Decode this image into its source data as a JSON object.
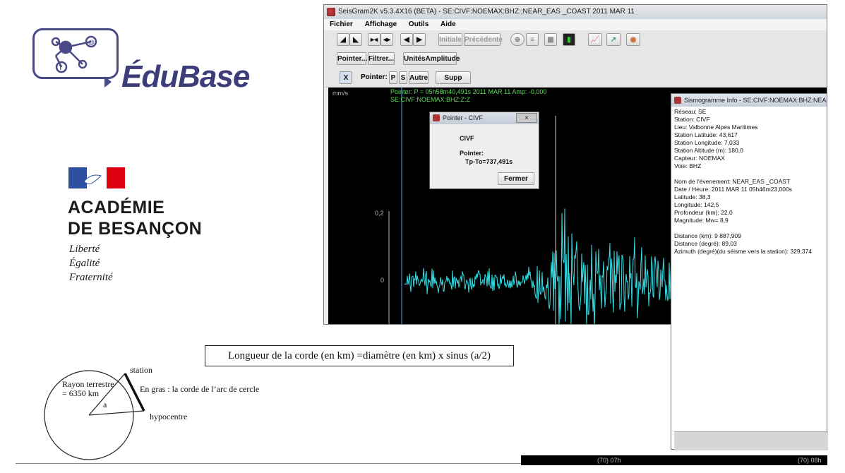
{
  "brand": {
    "logo_name": "ÉduBase",
    "academie_line1": "ACADÉMIE",
    "academie_line2": "DE BESANÇON",
    "devise": [
      "Liberté",
      "Égalité",
      "Fraternité"
    ],
    "colors": {
      "logo": "#3d3d7a",
      "flag_blue": "#2f4fa1",
      "flag_red": "#e1000f"
    }
  },
  "window": {
    "title": "SeisGram2K v5.3.4X16 (BETA) - SE:CIVF:NOEMAX:BHZ:;NEAR_EAS _COAST 2011 MAR 11",
    "menu": [
      "Fichier",
      "Affichage",
      "Outils",
      "Aide"
    ],
    "toolbar": {
      "initiale": "Initiale",
      "precedente": "Précédente",
      "pointer": "Pointer...",
      "filtrer": "Filtrer...",
      "unites": "UnitésAmplitude",
      "x": "X",
      "pointer_label": "Pointer:",
      "p": "P",
      "s": "S",
      "autre": "Autre",
      "supp": "Supp Tous"
    },
    "plot": {
      "unit": "mm/s",
      "pointer_line1": "Pointer: P = 05h58m40,491s 2011 MAR 11 Amp: -0,000",
      "pointer_line2": "SE:CIVF:NOEMAX:BHZ:Z:Z",
      "y_label_top": "0,2",
      "y_label_zero": "0",
      "time_labels": [
        "(70) 07h",
        "(70) 08h"
      ],
      "trace_color": "#33e0e8",
      "marker_color": "#3b8fd6"
    }
  },
  "dialog": {
    "title": "Pointer - CIVF",
    "close": "×",
    "station": "CIVF",
    "pointer_label": "Pointer:",
    "value": "Tp-To=737,491s",
    "button": "Fermer"
  },
  "info": {
    "title": "Sismogramme Info - SE:CIVF:NOEMAX:BHZ:NEAR_EAS _COAST",
    "lines": [
      "Réseau: SE",
      "Station: CIVF",
      "Lieu: Valbonne Alpes Maritimes",
      "Station Latitude: 43,617",
      "Station Longitude: 7,033",
      "Station Altitude (m): 180,0",
      "Capteur: NOEMAX",
      "Voie: BHZ",
      "",
      "Nom de l'évenement: NEAR_EAS _COAST",
      "Date / Heure: 2011 MAR 11  05h46m23,000s",
      "Latitude: 38,3",
      "Longitude: 142,5",
      "Profondeur (km): 22,0",
      "Magnitude: Mw= 8,9",
      "",
      "Distance (km): 9 887,909",
      "Distance (degré): 89,03",
      "Azimuth (degré)(du séisme vers la station): 329,374"
    ]
  },
  "diagram": {
    "formula": "Longueur de la corde (en km) =diamètre (en km) x sinus (a/2)",
    "rayon1": "Rayon terrestre",
    "rayon2": "= 6350 km",
    "angle": "a",
    "station": "station",
    "gras": "En gras : la corde de l’arc de cercle",
    "hypocentre": "hypocentre"
  }
}
